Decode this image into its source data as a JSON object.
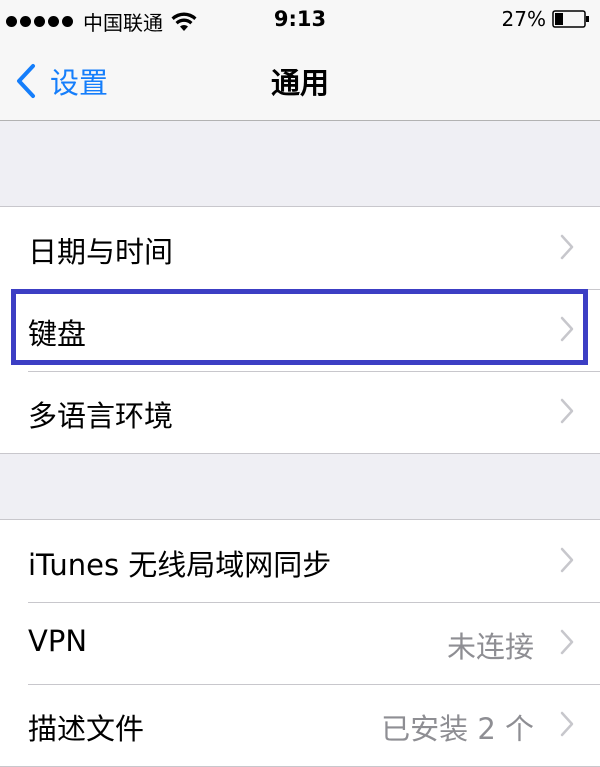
{
  "status_bar": {
    "carrier": "中国联通",
    "time": "9:13",
    "battery": "27%",
    "signal_icon": "signal-dots-icon",
    "wifi_icon": "wifi-icon",
    "battery_icon": "battery-icon"
  },
  "nav": {
    "back_label": "设置",
    "title": "通用",
    "back_icon": "chevron-left-icon"
  },
  "groups": [
    {
      "rows": [
        {
          "label": "日期与时间",
          "value": ""
        },
        {
          "label": "键盘",
          "value": ""
        },
        {
          "label": "多语言环境",
          "value": ""
        }
      ]
    },
    {
      "rows": [
        {
          "label": "iTunes 无线局域网同步",
          "value": ""
        },
        {
          "label": "VPN",
          "value": "未连接"
        },
        {
          "label": "描述文件",
          "value": "已安装 2 个"
        }
      ]
    }
  ],
  "colors": {
    "accent": "#157efb",
    "highlight_border": "#3c3ec4",
    "background": "#efeff4"
  }
}
